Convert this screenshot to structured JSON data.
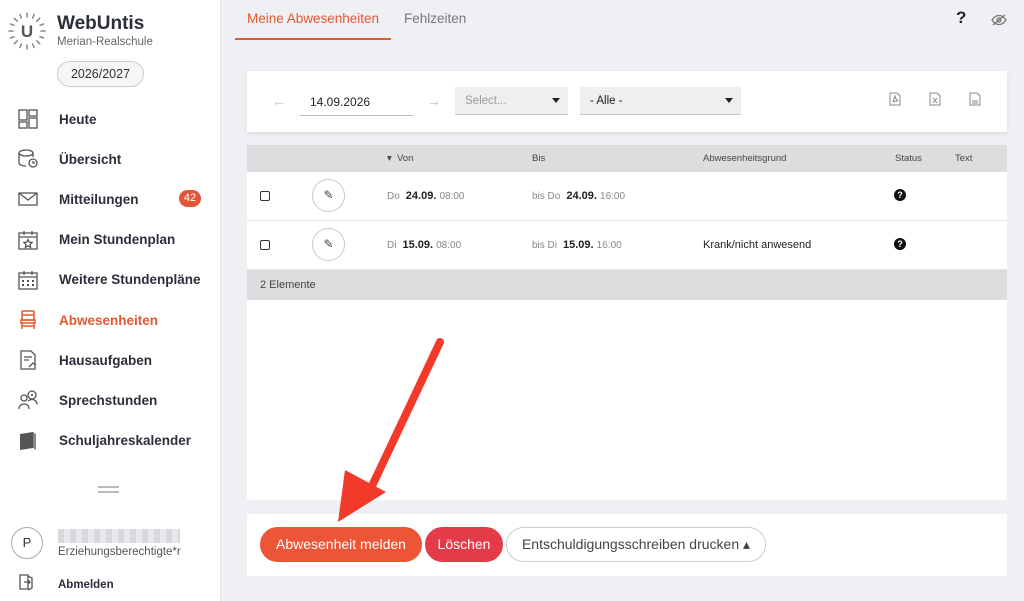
{
  "app": {
    "name": "WebUntis",
    "school": "Merian-Realschule",
    "year": "2026/2027"
  },
  "sidebar": {
    "items": [
      {
        "label": "Heute",
        "icon": "dashboard-icon"
      },
      {
        "label": "Übersicht",
        "icon": "overview-icon"
      },
      {
        "label": "Mitteilungen",
        "icon": "mail-icon",
        "badge": "42"
      },
      {
        "label": "Mein Stundenplan",
        "icon": "calendar-star-icon"
      },
      {
        "label": "Weitere Stundenpläne",
        "icon": "calendar-grid-icon"
      },
      {
        "label": "Abwesenheiten",
        "icon": "chair-icon",
        "active": true
      },
      {
        "label": "Hausaufgaben",
        "icon": "homework-icon"
      },
      {
        "label": "Sprechstunden",
        "icon": "people-icon"
      },
      {
        "label": "Schuljahreskalender",
        "icon": "book-icon"
      }
    ],
    "user": {
      "initial": "P",
      "role": "Erziehungsberechtigte*r"
    },
    "logout": "Abmelden"
  },
  "tabs": [
    "Meine Abwesenheiten",
    "Fehlzeiten"
  ],
  "header": {
    "help": "?"
  },
  "filter": {
    "date": "14.09.2026",
    "select_placeholder": "Select...",
    "select_all": "- Alle -"
  },
  "table": {
    "headers": {
      "from": "Von",
      "to": "Bis",
      "reason": "Abwesenheitsgrund",
      "status": "Status",
      "text": "Text"
    },
    "rows": [
      {
        "from_wd": "Do",
        "from_date": "24.09.",
        "from_time": "08:00",
        "to_wd": "bis Do",
        "to_date": "24.09.",
        "to_time": "16:00",
        "reason": "",
        "status": "?"
      },
      {
        "from_wd": "Di",
        "from_date": "15.09.",
        "from_time": "08:00",
        "to_wd": "bis Di",
        "to_date": "15.09.",
        "to_time": "16:00",
        "reason": "Krank/nicht anwesend",
        "status": "?"
      }
    ],
    "footer": "2 Elemente"
  },
  "actions": {
    "report": "Abwesenheit melden",
    "delete": "Löschen",
    "print": "Entschuldigungsschreiben drucken ▴"
  },
  "colors": {
    "accent": "#e2592f",
    "report_button": "#ec5636",
    "delete_button": "#e33b48",
    "annotation_arrow": "#f23a2b"
  }
}
